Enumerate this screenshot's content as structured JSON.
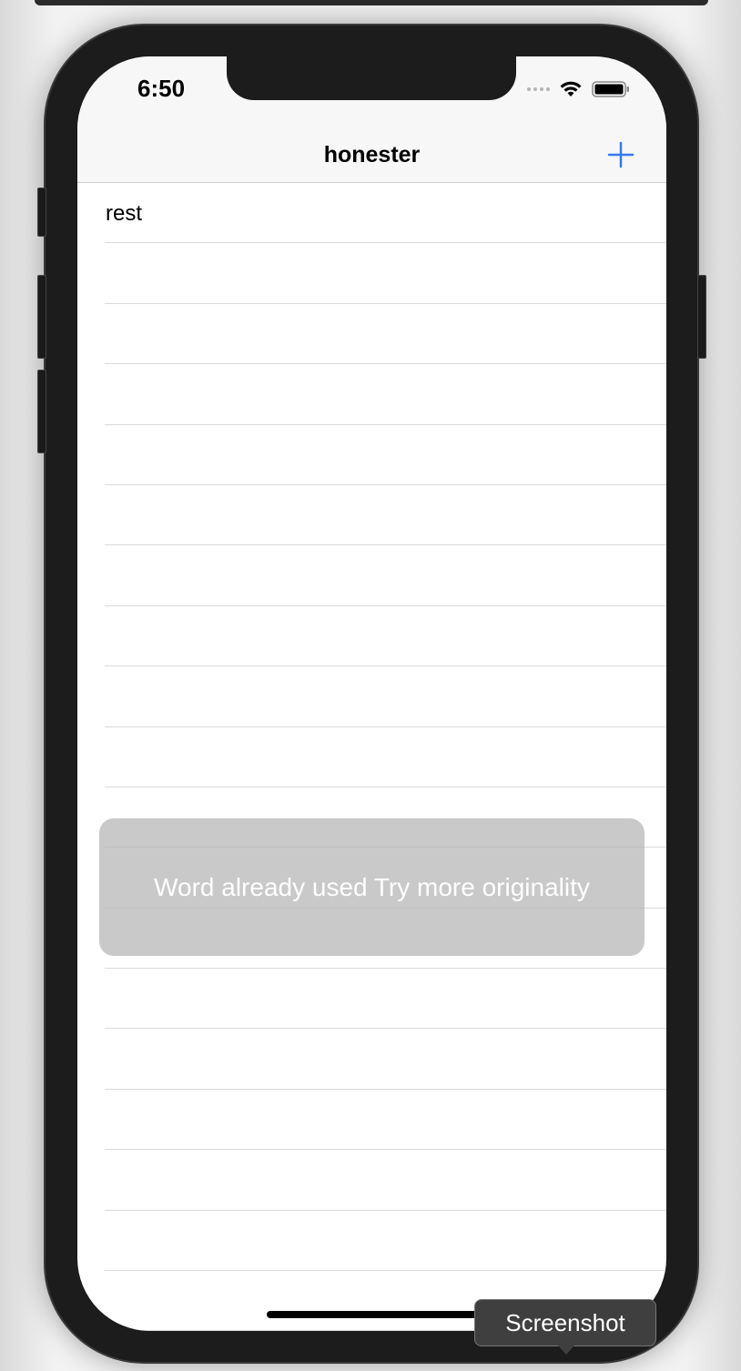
{
  "status_bar": {
    "time": "6:50"
  },
  "nav": {
    "title": "honester",
    "add_icon": "plus-icon"
  },
  "list": {
    "rows": [
      "rest",
      "",
      "",
      "",
      "",
      "",
      "",
      "",
      "",
      "",
      "",
      "",
      "",
      "",
      "",
      "",
      "",
      "",
      ""
    ]
  },
  "toast": {
    "message": "Word already used Try more originality"
  },
  "tooltip": {
    "label": "Screenshot"
  },
  "colors": {
    "accent": "#3478f6",
    "nav_background": "#f7f7f7",
    "toast_background": "#b4b4b4"
  }
}
